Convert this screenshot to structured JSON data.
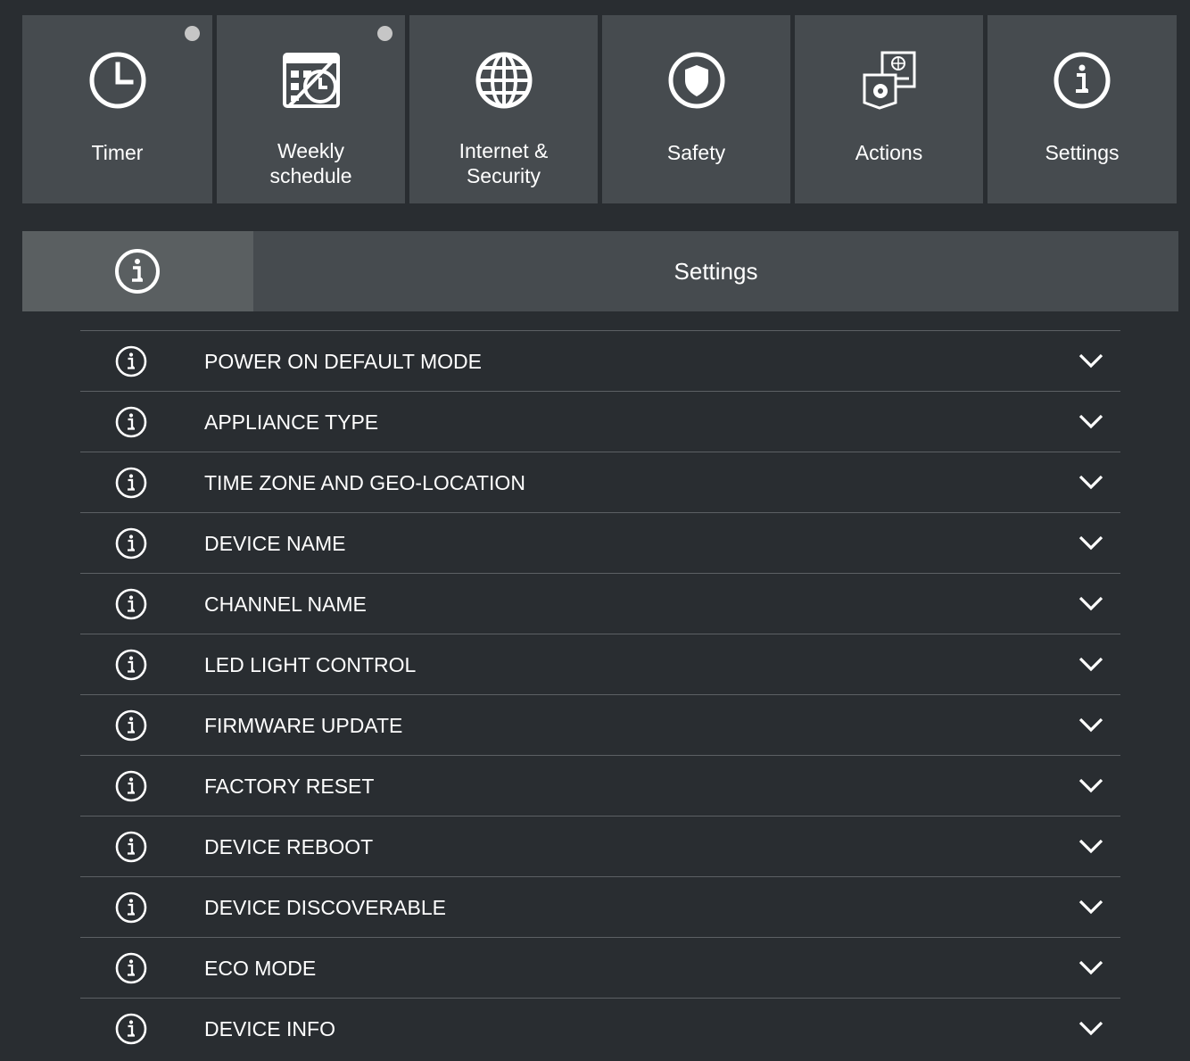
{
  "tiles": [
    {
      "name": "timer",
      "icon": "clock-icon",
      "lines": [
        "Timer"
      ],
      "indicator": true
    },
    {
      "name": "weekly-schedule",
      "icon": "calendar-icon",
      "lines": [
        "Weekly",
        "schedule"
      ],
      "indicator": true
    },
    {
      "name": "internet-security",
      "icon": "globe-icon",
      "lines": [
        "Internet &",
        "Security"
      ],
      "indicator": false
    },
    {
      "name": "safety",
      "icon": "shield-icon",
      "lines": [
        "Safety"
      ],
      "indicator": false
    },
    {
      "name": "actions",
      "icon": "actions-icon",
      "lines": [
        "Actions"
      ],
      "indicator": false
    },
    {
      "name": "settings",
      "icon": "info-icon",
      "lines": [
        "Settings"
      ],
      "indicator": false
    }
  ],
  "section": {
    "title": "Settings",
    "icon": "info-icon"
  },
  "settings_items": [
    {
      "label": "POWER ON DEFAULT MODE"
    },
    {
      "label": "APPLIANCE TYPE"
    },
    {
      "label": "TIME ZONE AND GEO-LOCATION"
    },
    {
      "label": "DEVICE NAME"
    },
    {
      "label": "CHANNEL NAME"
    },
    {
      "label": "LED LIGHT CONTROL"
    },
    {
      "label": "FIRMWARE UPDATE"
    },
    {
      "label": "FACTORY RESET"
    },
    {
      "label": "DEVICE REBOOT"
    },
    {
      "label": "DEVICE DISCOVERABLE"
    },
    {
      "label": "ECO MODE"
    },
    {
      "label": "DEVICE INFO"
    }
  ],
  "colors": {
    "background": "#292d31",
    "tile": "#464b4f",
    "tile_active_icon_box": "#5a5f61",
    "indicator": "#c6c6c6",
    "divider": "#5c6064",
    "text": "#ffffff"
  }
}
